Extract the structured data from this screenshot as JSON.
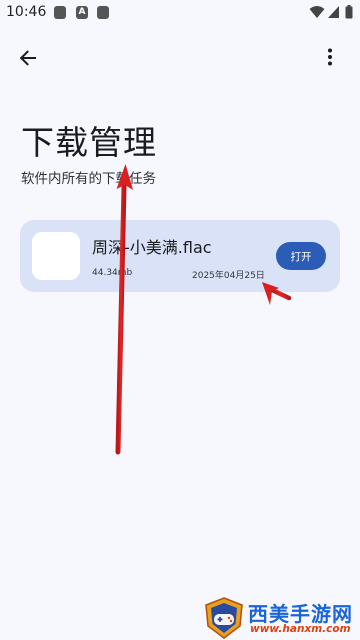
{
  "status_bar": {
    "time": "10:46",
    "notification_letter": "A",
    "icons": [
      "notification-icon",
      "a-notification-icon",
      "notification-icon",
      "wifi-icon",
      "signal-icon",
      "battery-icon"
    ]
  },
  "toolbar": {
    "back_icon": "arrow-back-icon",
    "more_icon": "more-vert-icon"
  },
  "page": {
    "title": "下载管理",
    "subtitle": "软件内所有的下载任务"
  },
  "downloads": [
    {
      "name": "周深-小美满.flac",
      "size": "44.34mb",
      "date": "2025年04月25日",
      "action_label": "打开"
    }
  ],
  "watermark": {
    "site_name": "西美手游网",
    "url": "www.hanxm.com"
  },
  "colors": {
    "background": "#f7f8fe",
    "card": "#d9e2f6",
    "accent": "#2c5db6",
    "annotation": "#e02020"
  }
}
